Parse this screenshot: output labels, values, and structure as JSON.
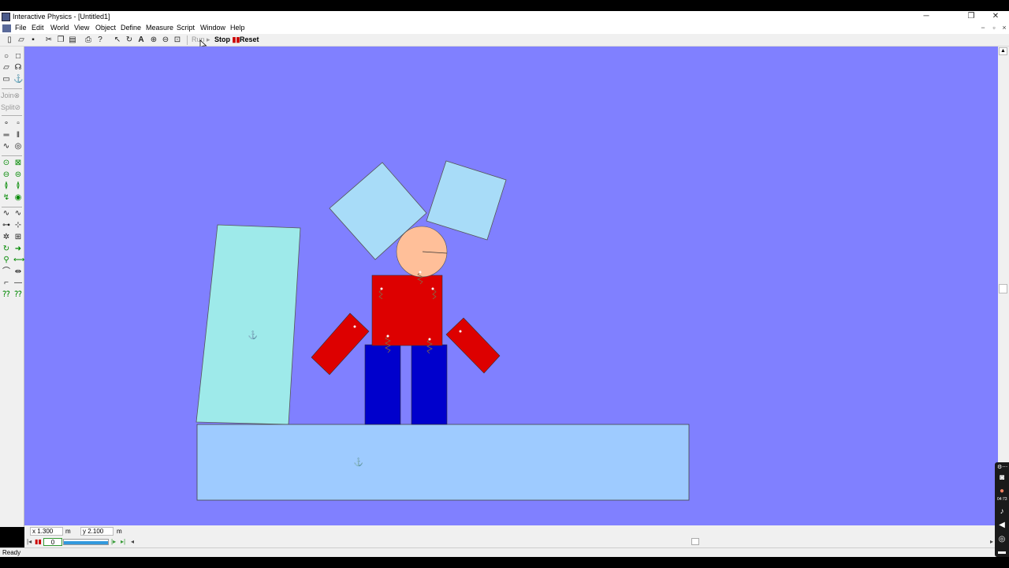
{
  "window": {
    "title": "Interactive Physics - [Untitled1]",
    "controls": {
      "minimize": "─",
      "restore": "❐",
      "close": "✕"
    },
    "mdi_controls": {
      "minimize": "−",
      "restore": "▫",
      "close": "×"
    }
  },
  "menu": {
    "items": [
      "File",
      "Edit",
      "World",
      "View",
      "Object",
      "Define",
      "Measure",
      "Script",
      "Window",
      "Help"
    ]
  },
  "toolbar": {
    "icons": [
      "new-icon",
      "open-icon",
      "save-icon",
      "cut-icon",
      "copy-icon",
      "paste-icon",
      "print-icon",
      "help-icon",
      "arrow-icon",
      "rotate-icon",
      "text-icon",
      "zoom-in-icon",
      "zoom-out-icon",
      "zoom-fit-icon"
    ],
    "run_label": "Run",
    "stop_label": "Stop",
    "reset_label": "Reset"
  },
  "palette": {
    "join_label": "Join",
    "split_label": "Split",
    "icons": [
      "circle-tool-icon",
      "square-tool-icon",
      "polygon-tool-icon",
      "curve-tool-icon",
      "rectangle-tool-icon",
      "anchor-tool-icon",
      "point-tool-icon",
      "square-point-tool-icon",
      "rod-tool-icon",
      "slot-tool-icon",
      "rope-tool-icon",
      "gear-tool-icon",
      "pin-joint-icon",
      "rigid-joint-icon",
      "spring-joint-icon",
      "damper-joint-icon",
      "spring-icon",
      "spring-damper-icon",
      "rotational-spring-icon",
      "rotational-damper-icon",
      "pulley-icon",
      "separator-icon",
      "force-icon",
      "torque-icon",
      "actuator-icon",
      "motor-icon",
      "rope-icon",
      "separator-line-icon",
      "pulley-line-icon",
      "constraint-icon",
      "curved-slot-icon",
      "straight-slot-icon"
    ]
  },
  "coords": {
    "x_label": "x",
    "x_value": "1.300",
    "y_label": "y",
    "y_value": "2.100",
    "unit": "m"
  },
  "frame": {
    "counter": "0"
  },
  "status": {
    "text": "Ready"
  },
  "colors": {
    "background": "#8080ff",
    "tall_block": "#9eeaea",
    "ground": "#9ecbff",
    "squares": "#a8dcf8",
    "head": "#ffbf99",
    "torso": "#dd0000",
    "arms": "#dd0000",
    "legs": "#0000cc"
  },
  "recorder": {
    "icons": [
      "recorder-menu-icon",
      "camera-icon",
      "record-icon",
      "mic-icon",
      "speaker-icon",
      "webcam-icon",
      "keyboard-icon"
    ],
    "timer": "04:73"
  }
}
